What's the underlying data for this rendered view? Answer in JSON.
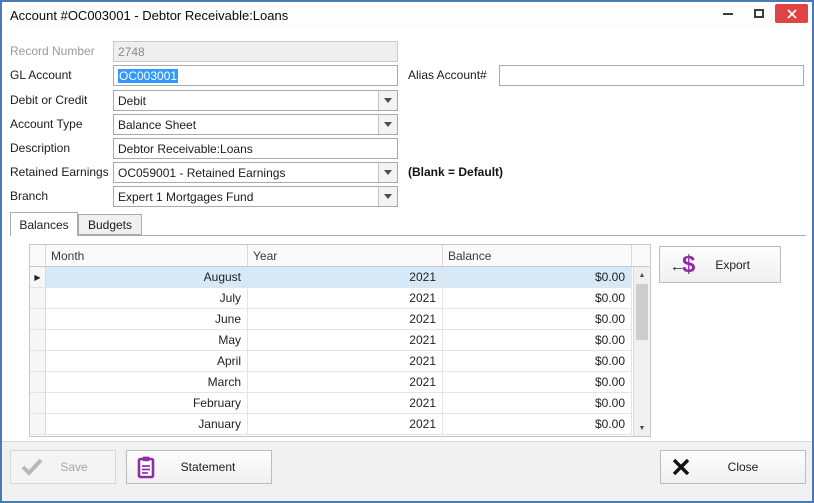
{
  "window": {
    "title": "Account #OC003001 - Debtor Receivable:Loans"
  },
  "icons": {
    "row_selector": "▶",
    "scroll_up": "▲",
    "scroll_down": "▼",
    "export_arrow": "←",
    "export_dollar": "$"
  },
  "form": {
    "record_number": {
      "label": "Record Number",
      "value": "2748"
    },
    "gl_account": {
      "label": "GL Account",
      "value": "OC003001"
    },
    "alias_account": {
      "label": "Alias Account#",
      "value": ""
    },
    "debit_or_credit": {
      "label": "Debit or Credit",
      "value": "Debit"
    },
    "account_type": {
      "label": "Account Type",
      "value": "Balance Sheet"
    },
    "description": {
      "label": "Description",
      "value": "Debtor Receivable:Loans"
    },
    "retained_earnings": {
      "label": "Retained Earnings",
      "value": "OC059001 - Retained Earnings",
      "note": "(Blank = Default)"
    },
    "branch": {
      "label": "Branch",
      "value": "Expert 1 Mortgages Fund"
    }
  },
  "tabs": {
    "balances": "Balances",
    "budgets": "Budgets"
  },
  "grid": {
    "columns": {
      "month": "Month",
      "year": "Year",
      "balance": "Balance"
    },
    "rows": [
      {
        "month": "August",
        "year": "2021",
        "balance": "$0.00",
        "selected": true
      },
      {
        "month": "July",
        "year": "2021",
        "balance": "$0.00",
        "selected": false
      },
      {
        "month": "June",
        "year": "2021",
        "balance": "$0.00",
        "selected": false
      },
      {
        "month": "May",
        "year": "2021",
        "balance": "$0.00",
        "selected": false
      },
      {
        "month": "April",
        "year": "2021",
        "balance": "$0.00",
        "selected": false
      },
      {
        "month": "March",
        "year": "2021",
        "balance": "$0.00",
        "selected": false
      },
      {
        "month": "February",
        "year": "2021",
        "balance": "$0.00",
        "selected": false
      },
      {
        "month": "January",
        "year": "2021",
        "balance": "$0.00",
        "selected": false
      }
    ]
  },
  "buttons": {
    "export": "Export",
    "save": "Save",
    "statement": "Statement",
    "close": "Close"
  },
  "colors": {
    "window_border": "#4a7ab5",
    "close_button": "#e04343",
    "text_selection": "#3399ff",
    "selected_row": "#d6e9f8",
    "purple_icon": "#8e2da8"
  }
}
